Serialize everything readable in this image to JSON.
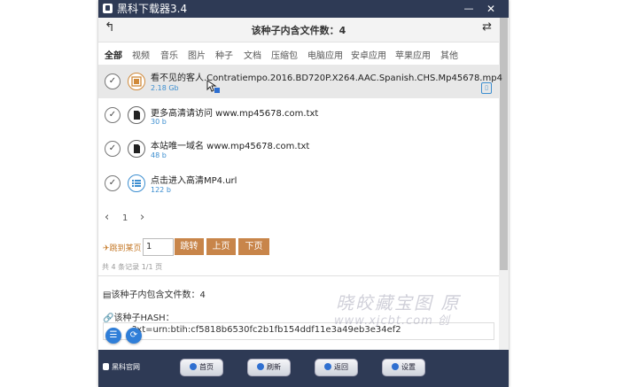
{
  "window": {
    "title": "黑科下载器3.4"
  },
  "header": {
    "title": "该种子内含文件数：4"
  },
  "categories": [
    "全部",
    "视频",
    "音乐",
    "图片",
    "种子",
    "文档",
    "压缩包",
    "电脑应用",
    "安卓应用",
    "苹果应用",
    "其他"
  ],
  "files": [
    {
      "name": "看不见的客人.Contratiempo.2016.BD720P.X264.AAC.Spanish.CHS.Mp45678.mp4",
      "size": "2.18 Gb",
      "icon": "film-icon"
    },
    {
      "name": "更多高清请访问 www.mp45678.com.txt",
      "size": "30 b",
      "icon": "document-icon"
    },
    {
      "name": "本站唯一域名 www.mp45678.com.txt",
      "size": "48 b",
      "icon": "document-icon"
    },
    {
      "name": "点击进入高清MP4.url",
      "size": "122 b",
      "icon": "list-icon"
    }
  ],
  "pager": {
    "current": "1",
    "prev": "‹",
    "next": "›"
  },
  "jump": {
    "label": "✈跳到某页",
    "value": "1",
    "go": "跳转",
    "prev": "上页",
    "next": "下页"
  },
  "records": "共 4 条记录 1/1 页",
  "info": {
    "file_count": "该种子内包含文件数：4",
    "hash_label": "该种子HASH：",
    "hash_value": "?xt=urn:btih:cf5818b6530fc2b1fb154ddf11e3a49eb3e34ef2"
  },
  "watermark": {
    "line1": "晓皎藏宝图  原",
    "line2": "www.xjcbt.com   创"
  },
  "footer": {
    "brand": "黑科官网",
    "home": "首页",
    "refresh": "刷新",
    "back": "返回",
    "settings": "设置"
  },
  "colors": {
    "titlebar": "#2e3a55",
    "accent_blue": "#3c8ed0",
    "accent_orange": "#c8854a"
  }
}
